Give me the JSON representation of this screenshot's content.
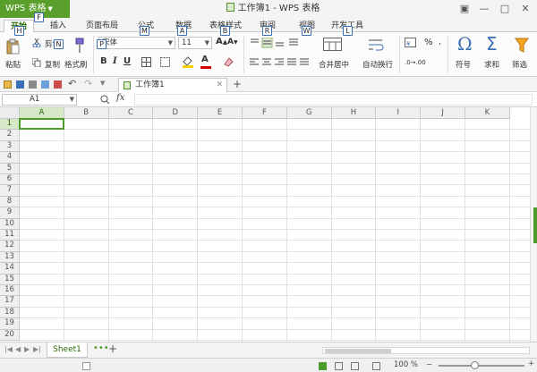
{
  "titlebar": {
    "app_button": "WPS 表格",
    "window_title": "工作簿1 - WPS 表格",
    "controls": [
      "minimize-icon",
      "maximize-icon",
      "close-icon"
    ]
  },
  "tabs": [
    {
      "label": "开始",
      "key": "H",
      "active": true
    },
    {
      "label": "插入",
      "key": "N"
    },
    {
      "label": "页面布局",
      "key": "P"
    },
    {
      "label": "公式",
      "key": "M"
    },
    {
      "label": "数据",
      "key": "A"
    },
    {
      "label": "表格样式",
      "key": "B"
    },
    {
      "label": "审阅",
      "key": "R"
    },
    {
      "label": "视图",
      "key": "W"
    },
    {
      "label": "开发工具",
      "key": "L"
    }
  ],
  "app_key": "F",
  "ribbon": {
    "paste": "粘贴",
    "cut": "剪切",
    "copy": "复制",
    "format_painter": "格式刷",
    "font_name": "宋体",
    "font_size": "11",
    "merge_center": "合并居中",
    "wrap_text": "自动换行",
    "number_format": "%",
    "symbol": "符号",
    "sum": "求和",
    "filter": "筛选"
  },
  "quickbar": {
    "doc_tab": "工作簿1",
    "new_tab": "+"
  },
  "formula": {
    "name_box": "A1",
    "fx": "fx",
    "value": ""
  },
  "grid": {
    "columns": [
      "A",
      "B",
      "C",
      "D",
      "E",
      "F",
      "G",
      "H",
      "I",
      "J",
      "K"
    ],
    "rows": [
      "1",
      "2",
      "3",
      "4",
      "5",
      "6",
      "7",
      "8",
      "9",
      "10",
      "11",
      "12",
      "13",
      "14",
      "15",
      "16",
      "17",
      "18",
      "19",
      "20"
    ],
    "active_cell": "A1"
  },
  "sheetbar": {
    "sheet_tab": "Sheet1",
    "add_sheet": "+"
  },
  "statusbar": {
    "zoom": "100 %"
  },
  "colors": {
    "accent": "#5a9f2c",
    "active_cell_border": "#4d9b2a"
  }
}
